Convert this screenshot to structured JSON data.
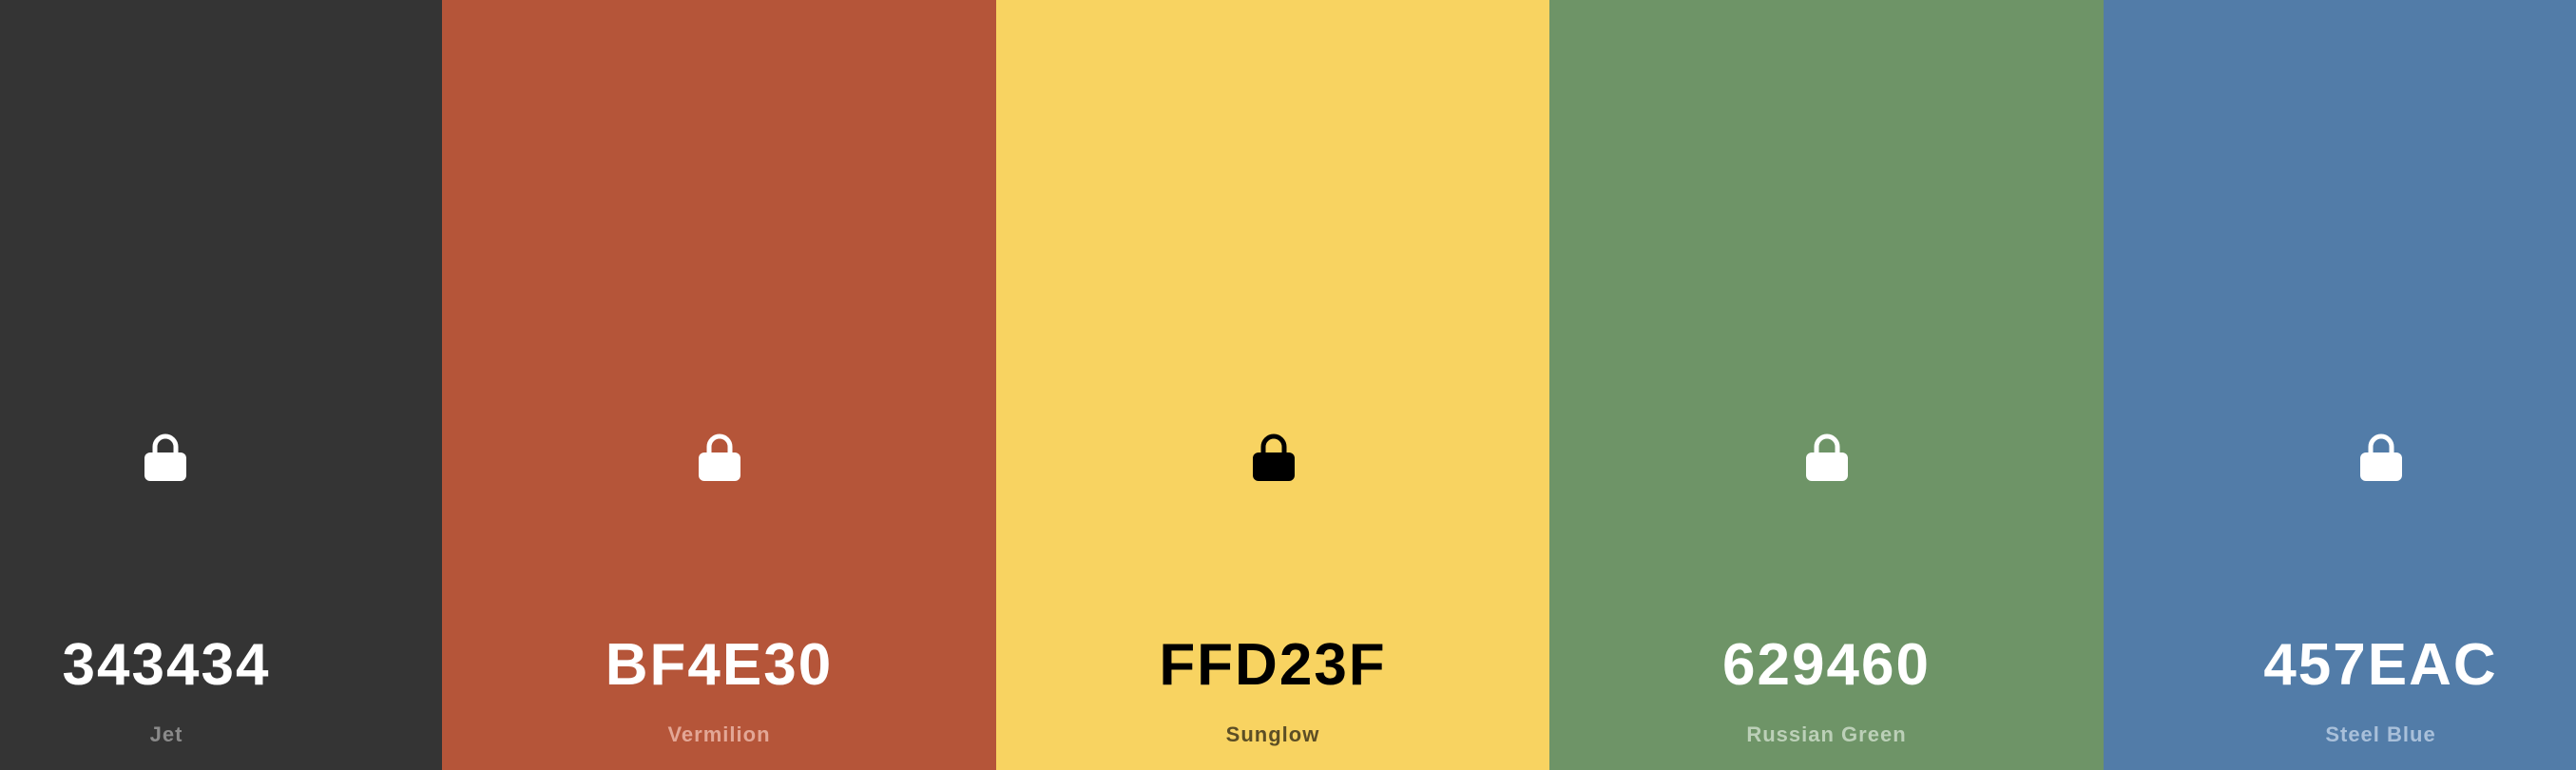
{
  "palette": {
    "swatches": [
      {
        "hex": "343434",
        "name": "Jet",
        "color": "#343434",
        "text_color": "#FFFFFF",
        "name_color": "#8A8A8A",
        "icon": "lock-icon",
        "icon_color": "#FFFFFF"
      },
      {
        "hex": "BF4E30",
        "name": "Vermilion",
        "color": "#B55539",
        "text_color": "#FFFFFF",
        "name_color": "#E3A796",
        "icon": "lock-icon",
        "icon_color": "#FFFFFF"
      },
      {
        "hex": "FFD23F",
        "name": "Sunglow",
        "color": "#F8D361",
        "text_color": "#000000",
        "name_color": "#5C4E25",
        "icon": "lock-icon",
        "icon_color": "#000000"
      },
      {
        "hex": "629460",
        "name": "Russian Green",
        "color": "#6E9467",
        "text_color": "#FFFFFF",
        "name_color": "#BCD0B8",
        "icon": "lock-icon",
        "icon_color": "#FFFFFF"
      },
      {
        "hex": "457EAC",
        "name": "Steel Blue",
        "color": "#527CA8",
        "text_color": "#FFFFFF",
        "name_color": "#A9C0DA",
        "icon": "lock-icon",
        "icon_color": "#FFFFFF"
      }
    ]
  }
}
